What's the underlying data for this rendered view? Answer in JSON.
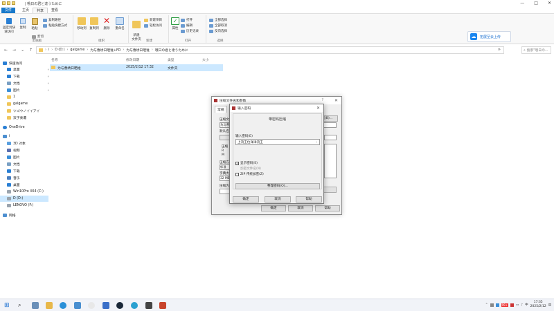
{
  "window": {
    "title": "| 哦日の君と達うために",
    "controls": [
      "—",
      "□",
      "✕"
    ]
  },
  "ribbon_tabs": [
    "文件",
    "主页",
    "共享",
    "查看"
  ],
  "ribbon": {
    "groups": {
      "clipboard": {
        "label": "剪贴板",
        "pin_label": "固定到快速访问",
        "copy_label": "复制",
        "paste_label": "粘贴",
        "copy_path_label": "复制路径",
        "paste_shortcut_label": "粘贴快捷方式",
        "cut_label": "剪切"
      },
      "organize": {
        "label": "组织",
        "move_to_label": "移动到",
        "copy_to_label": "复制到",
        "delete_label": "删除",
        "rename_label": "重命名"
      },
      "new": {
        "label": "新建",
        "new_folder_label": "新建\n文件夹",
        "new_item_label": "新建项目",
        "easy_access_label": "轻松访问"
      },
      "open": {
        "label": "打开",
        "properties_label": "属性",
        "open_label": "打开",
        "edit_label": "编辑",
        "history_label": "历史记录"
      },
      "select": {
        "label": "选择",
        "select_all_label": "全部选择",
        "select_none_label": "全部取消",
        "invert_label": "反向选择"
      }
    },
    "cloud_button_label": "拓展至云上传"
  },
  "address": {
    "segments": [
      "D (D:)",
      "galgame",
      "为与曹绣日晒谁+FD",
      "为与曹绣日晒谁",
      "哦日の君と達うために"
    ],
    "search_placeholder": "搜索\"哦日の..."
  },
  "nav": {
    "items": [
      {
        "label": "快速访问",
        "pin": ""
      },
      {
        "label": "桌面",
        "pin": "✱"
      },
      {
        "label": "下载",
        "pin": "✱"
      },
      {
        "label": "文档",
        "pin": "✱"
      },
      {
        "label": "图片",
        "pin": "✱"
      },
      {
        "label": "1",
        "pin": ""
      },
      {
        "label": "galgame",
        "pin": ""
      },
      {
        "label": "ツゴウノイイアイ",
        "pin": ""
      },
      {
        "label": "双子奏遭",
        "pin": ""
      },
      {
        "label": "OneDrive",
        "pin": ""
      },
      {
        "label": "i",
        "pin": ""
      },
      {
        "label": "3D 对象",
        "pin": ""
      },
      {
        "label": "视频",
        "pin": ""
      },
      {
        "label": "图片",
        "pin": ""
      },
      {
        "label": "文档",
        "pin": ""
      },
      {
        "label": "下载",
        "pin": ""
      },
      {
        "label": "音乐",
        "pin": ""
      },
      {
        "label": "桌面",
        "pin": ""
      },
      {
        "label": "Win10Pro X64 (C:)",
        "pin": ""
      },
      {
        "label": "D (D:)",
        "pin": ""
      },
      {
        "label": "LENOVO (F:)",
        "pin": ""
      },
      {
        "label": "网络",
        "pin": ""
      }
    ]
  },
  "filelist": {
    "headers": [
      "名称",
      "修改日期",
      "类型",
      "大小"
    ],
    "rows": [
      {
        "name": "为与曹绣日晒谁",
        "date": "2025/2/12 17:32",
        "type": "文件夹",
        "size": ""
      }
    ]
  },
  "compress_dialog": {
    "title": "压缩文件名和参数",
    "help": "?",
    "tab": "常规",
    "labels": [
      "压缩文",
      "为与曹",
      "默认名",
      "压缩",
      "R",
      "M",
      "压缩方",
      "标准",
      "字典大",
      "32 MB",
      "压缩为"
    ],
    "browse": "浏览(B)...",
    "ok": "确定",
    "cancel": "取消",
    "help_btn": "帮助"
  },
  "password_dialog": {
    "title": "输入密码",
    "group_title": "带密码压缩",
    "password_label": "输入密码(E)",
    "password_value": "上流王位洋洋流王",
    "show_password": "显示密码(S)",
    "encrypt_names": "加密文件名(N)",
    "zip_legacy": "ZIP 传统加密(Z)",
    "manage": "整理密码(O)...",
    "ok": "确定",
    "cancel": "取消",
    "help": "帮助"
  },
  "taskbar": {
    "clock_time": "17:35",
    "clock_date": "2025/2/12",
    "lang": "中",
    "tray_badge": "99+"
  }
}
